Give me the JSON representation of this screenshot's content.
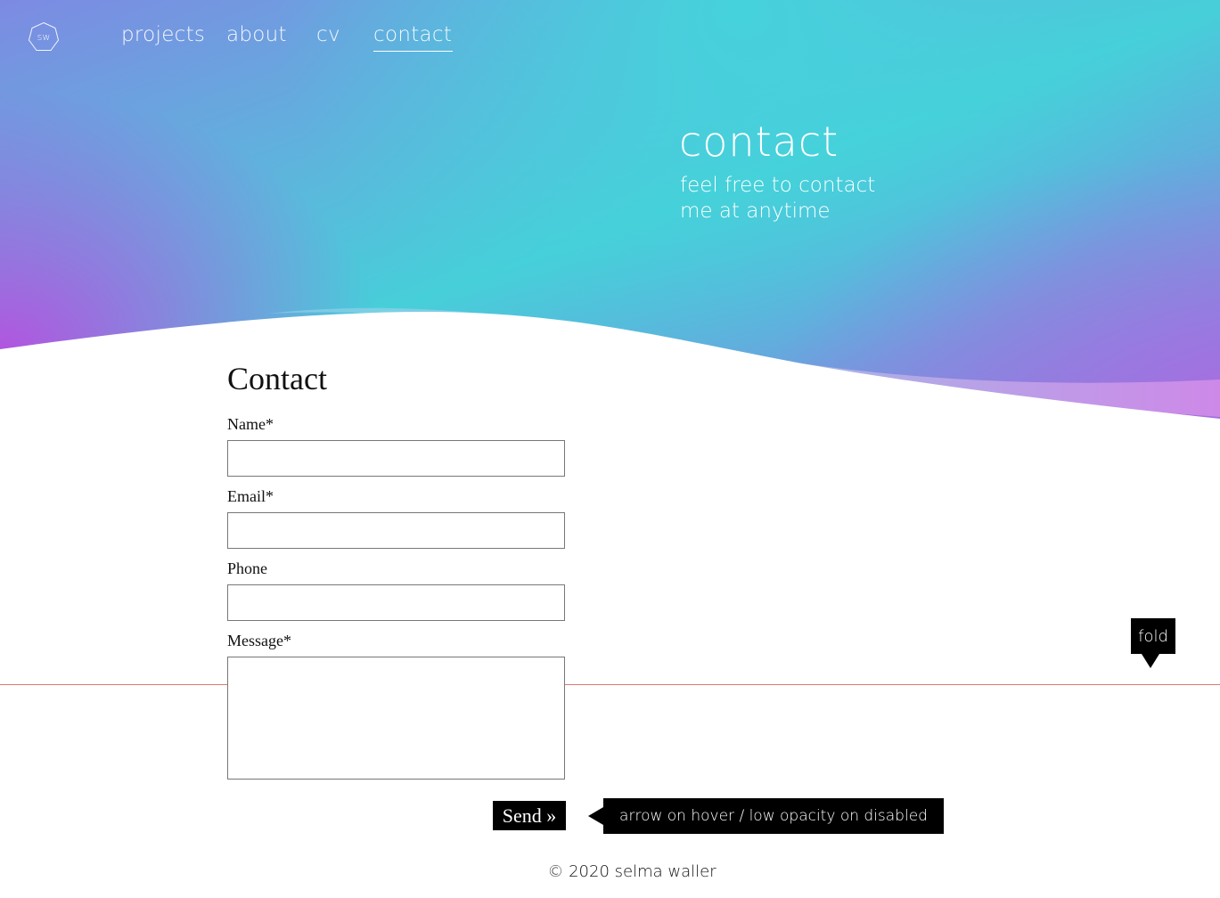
{
  "header": {
    "logo_text": "sw",
    "nav": [
      {
        "label": "projects",
        "active": false
      },
      {
        "label": "about",
        "active": false
      },
      {
        "label": "cv",
        "active": false
      },
      {
        "label": "contact",
        "active": true
      }
    ]
  },
  "hero": {
    "title": "contact",
    "subtitle_line1": "feel free to contact",
    "subtitle_line2": "me at anytime"
  },
  "form": {
    "title": "Contact",
    "fields": [
      {
        "label": "Name*",
        "value": ""
      },
      {
        "label": "Email*",
        "value": ""
      },
      {
        "label": "Phone",
        "value": ""
      },
      {
        "label": "Message*",
        "value": ""
      }
    ],
    "send_label": "Send »"
  },
  "annotations": {
    "fold": "fold",
    "send_note": "arrow on hover / low opacity on disabled"
  },
  "footer": {
    "copyright": "© 2020 selma waller"
  },
  "colors": {
    "gradient_cyan": "#46cfd9",
    "gradient_magenta": "#c440e0",
    "fold_line": "#dd7777"
  }
}
